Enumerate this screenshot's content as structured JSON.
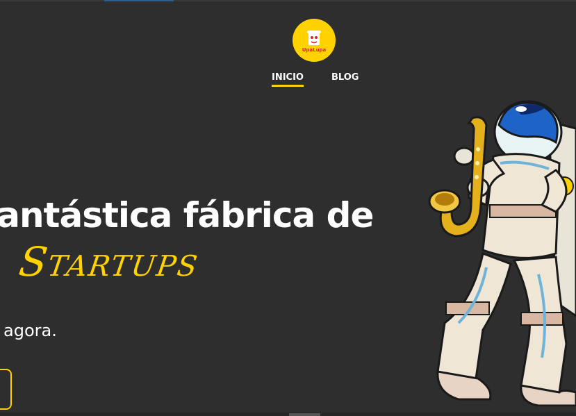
{
  "logo": {
    "text": "UpaLupa"
  },
  "nav": {
    "items": [
      "INICIO",
      "BLOG"
    ],
    "active": "INICIO"
  },
  "hero": {
    "title": "Fantástica fábrica de",
    "highlight": "Startups",
    "subtitle": "agora."
  },
  "colors": {
    "background": "#2e2e2e",
    "accent": "#ffd200",
    "text": "#ffffff"
  },
  "icons": [
    "upalupa-logo-icon",
    "astronaut-saxophone-illustration"
  ]
}
